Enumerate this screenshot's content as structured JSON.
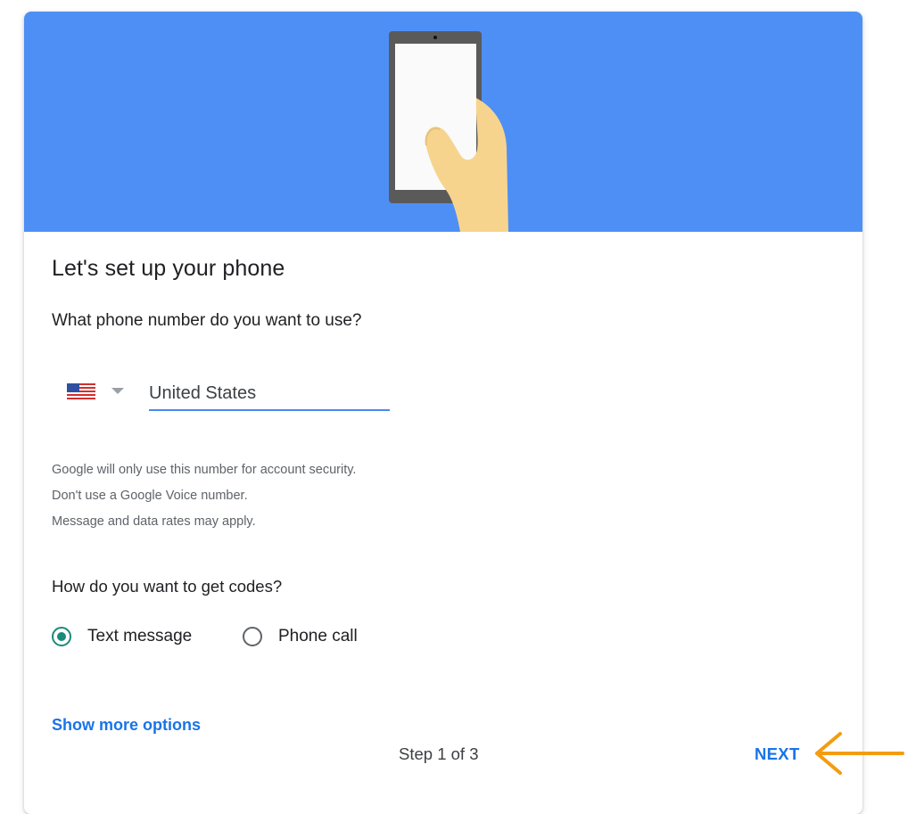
{
  "header": {
    "illustration": "hand-holding-phone"
  },
  "content": {
    "title": "Let's set up your phone",
    "question": "What phone number do you want to use?",
    "country": {
      "flag": "us-flag-icon",
      "value": "United States"
    },
    "notes": [
      "Google will only use this number for account security.",
      "Don't use a Google Voice number.",
      "Message and data rates may apply."
    ],
    "codes_question": "How do you want to get codes?",
    "code_options": [
      {
        "label": "Text message",
        "selected": true
      },
      {
        "label": "Phone call",
        "selected": false
      }
    ]
  },
  "footer": {
    "more_options": "Show more options",
    "step": "Step 1 of 3",
    "next": "NEXT"
  },
  "colors": {
    "hero": "#4e8ff5",
    "accent": "#1a73e8",
    "radio": "#1a8a7a",
    "arrow": "#f39c12"
  }
}
